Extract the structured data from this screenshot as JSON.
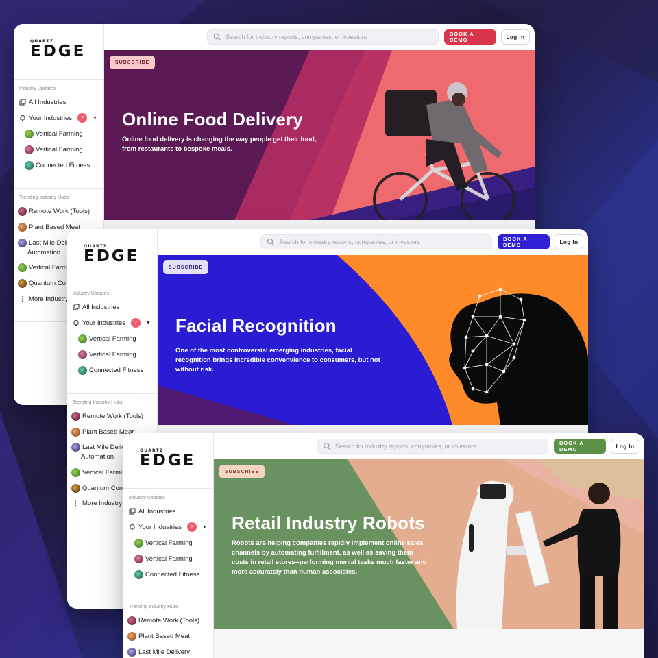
{
  "shared": {
    "brand_small": "QUARTZ",
    "brand_big": "EDGE",
    "search_placeholder": "Search for industry reports, companies, or investors",
    "book_demo": "BOOK A DEMO",
    "login": "Log In",
    "subscribe": "SUBSCRIBE",
    "industry_updates": "Industry Updates",
    "all_industries": "All Industries",
    "your_industries": "Your Industries",
    "your_count": "2",
    "followed": [
      "Vertical Farming",
      "Vertical Farming",
      "Connected Fitness"
    ],
    "trending_heading": "Trending Industry Hubs",
    "trending_full": [
      "Remote Work (Tools)",
      "Plant Based Meat",
      "Last Mile Delivery"
    ],
    "trending_card1": [
      "Remote Work (Tools)",
      "Plant Based Meat",
      "Last Mile Deli",
      "Automation",
      "Vertical Farm",
      "Quantum Co",
      "More Industry"
    ],
    "trending_card2": [
      "Remote Work (Tools)",
      "Plant Based Meat",
      "Last Mile Deliv",
      "Automation",
      "Vertical Farmi",
      "Quantum Com",
      "More Industry I"
    ]
  },
  "cards": [
    {
      "title": "Online Food Delivery",
      "description": "Online food delivery is changing the way people get their food, from restaurants to bespoke meals.",
      "demo_color": "#d9354b",
      "subscribe_bg": "#f9c9c9",
      "subscribe_fg": "#7a1d2c"
    },
    {
      "title": "Facial Recognition",
      "description": "One of the most controversial emerging industries, facial recognition brings incredible convenvience to consumers, but not without risk.",
      "demo_color": "#2f20d6",
      "subscribe_bg": "#e5e1fb",
      "subscribe_fg": "#2a1f7a"
    },
    {
      "title": "Retail Industry Robots",
      "description": "Robots are helping companies rapidly implement online sales channels by automating fulfillment, as well as saving them costs in retail stores--performing menial tasks much faster and more accurately than human associates.",
      "demo_color": "#5b9147",
      "subscribe_bg": "#f7d4c4",
      "subscribe_fg": "#7a3a22"
    }
  ]
}
